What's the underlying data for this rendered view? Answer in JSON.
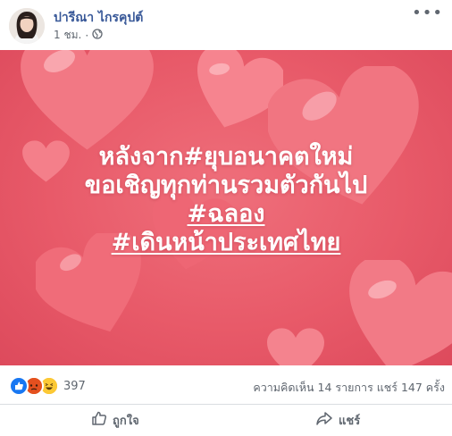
{
  "post": {
    "author": "ปารีณา ไกรคุปต์",
    "time": "1 ชม.",
    "separator": "·",
    "more_label": "•••"
  },
  "image": {
    "lines": [
      "หลังจาก#ยุบอนาคตใหม่",
      "ขอเชิญทุกท่านรวมตัวกันไป",
      "#ฉลอง",
      "#เดินหน้าประเทศไทย"
    ],
    "background_color": "#e85a69",
    "heart_color": "#f16f7c"
  },
  "stats": {
    "reaction_icons": [
      "like-icon",
      "angry-icon",
      "haha-icon"
    ],
    "reaction_count": "397",
    "comments_shares": "ความคิดเห็น 14 รายการ  แชร์ 147 ครั้ง"
  },
  "actions": {
    "like_label": "ถูกใจ",
    "share_label": "แชร์"
  },
  "colors": {
    "link": "#385898",
    "secondary_text": "#606770",
    "like_blue": "#1877f2"
  }
}
